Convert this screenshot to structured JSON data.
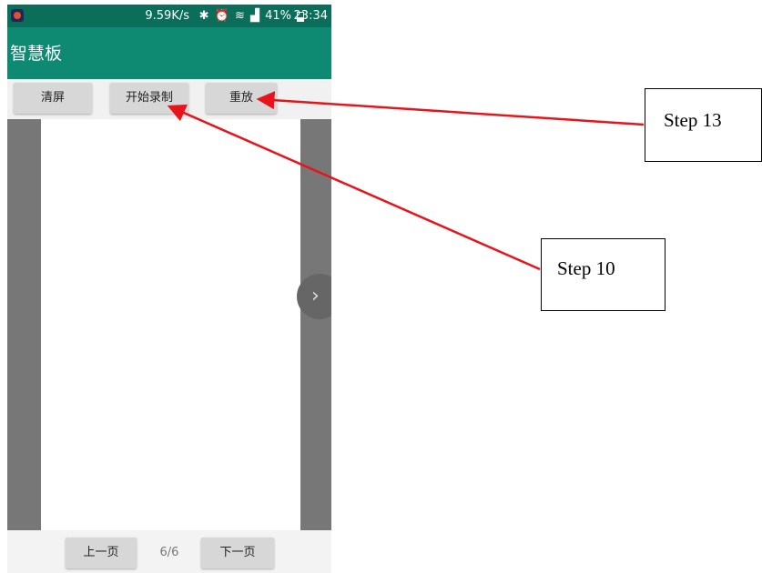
{
  "status_bar": {
    "net_speed": "9.59K/s",
    "icons": [
      "bluetooth-icon",
      "alarm-icon",
      "wifi-icon",
      "4g-signal-icon"
    ],
    "icons_glyphs": "✱ ⏰ ≋ ▟",
    "battery_percent": "41%",
    "battery_level": 0.41,
    "time": "23:34"
  },
  "app_bar": {
    "title": "智慧板"
  },
  "toolbar": {
    "clear_label": "清屏",
    "record_label": "开始录制",
    "replay_label": "重放"
  },
  "canvas": {
    "next_arrow_glyph": "›"
  },
  "pager": {
    "prev_label": "上一页",
    "page_indicator": "6/6",
    "next_label": "下一页"
  },
  "annotations": {
    "step13_label": "Step 13",
    "step10_label": "Step 10",
    "arrow_color": "#e8141b"
  },
  "colors": {
    "status_bar": "#0a6e5a",
    "app_bar": "#0f8a72",
    "margin": "#777777"
  }
}
